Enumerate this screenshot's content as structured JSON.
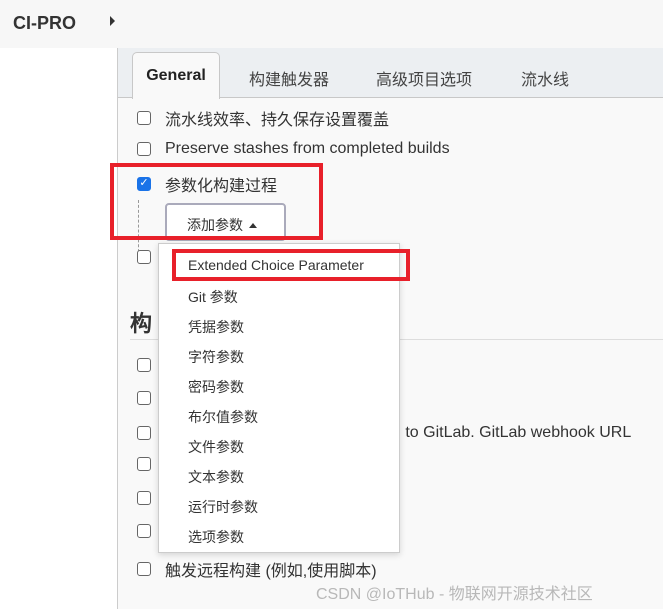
{
  "header": {
    "breadcrumb": "CI-PRO"
  },
  "tabs": [
    {
      "label": "General",
      "active": true
    },
    {
      "label": "构建触发器"
    },
    {
      "label": "高级项目选项"
    },
    {
      "label": "流水线"
    }
  ],
  "general": {
    "options": [
      {
        "label": "流水线效率、持久保存设置覆盖",
        "checked": false
      },
      {
        "label": "Preserve stashes from completed builds",
        "checked": false
      },
      {
        "label": "参数化构建过程",
        "checked": true
      }
    ],
    "add_param_label": "添加参数"
  },
  "triggers": {
    "heading": "构",
    "options": [
      {
        "label": ""
      },
      {
        "label": ""
      },
      {
        "label": "d to GitLab. GitLab webhook URL"
      },
      {
        "label": ""
      },
      {
        "label": ""
      },
      {
        "label": ""
      },
      {
        "label": "触发远程构建 (例如,使用脚本)"
      }
    ]
  },
  "menu": {
    "items": [
      "Extended Choice Parameter",
      "Git 参数",
      "凭据参数",
      "字符参数",
      "密码参数",
      "布尔值参数",
      "文件参数",
      "文本参数",
      "运行时参数",
      "选项参数"
    ]
  },
  "colors": {
    "highlight": "#e8202a",
    "checkbox": "#1a73e8"
  },
  "watermark": "CSDN @IoTHub - 物联网开源技术社区"
}
